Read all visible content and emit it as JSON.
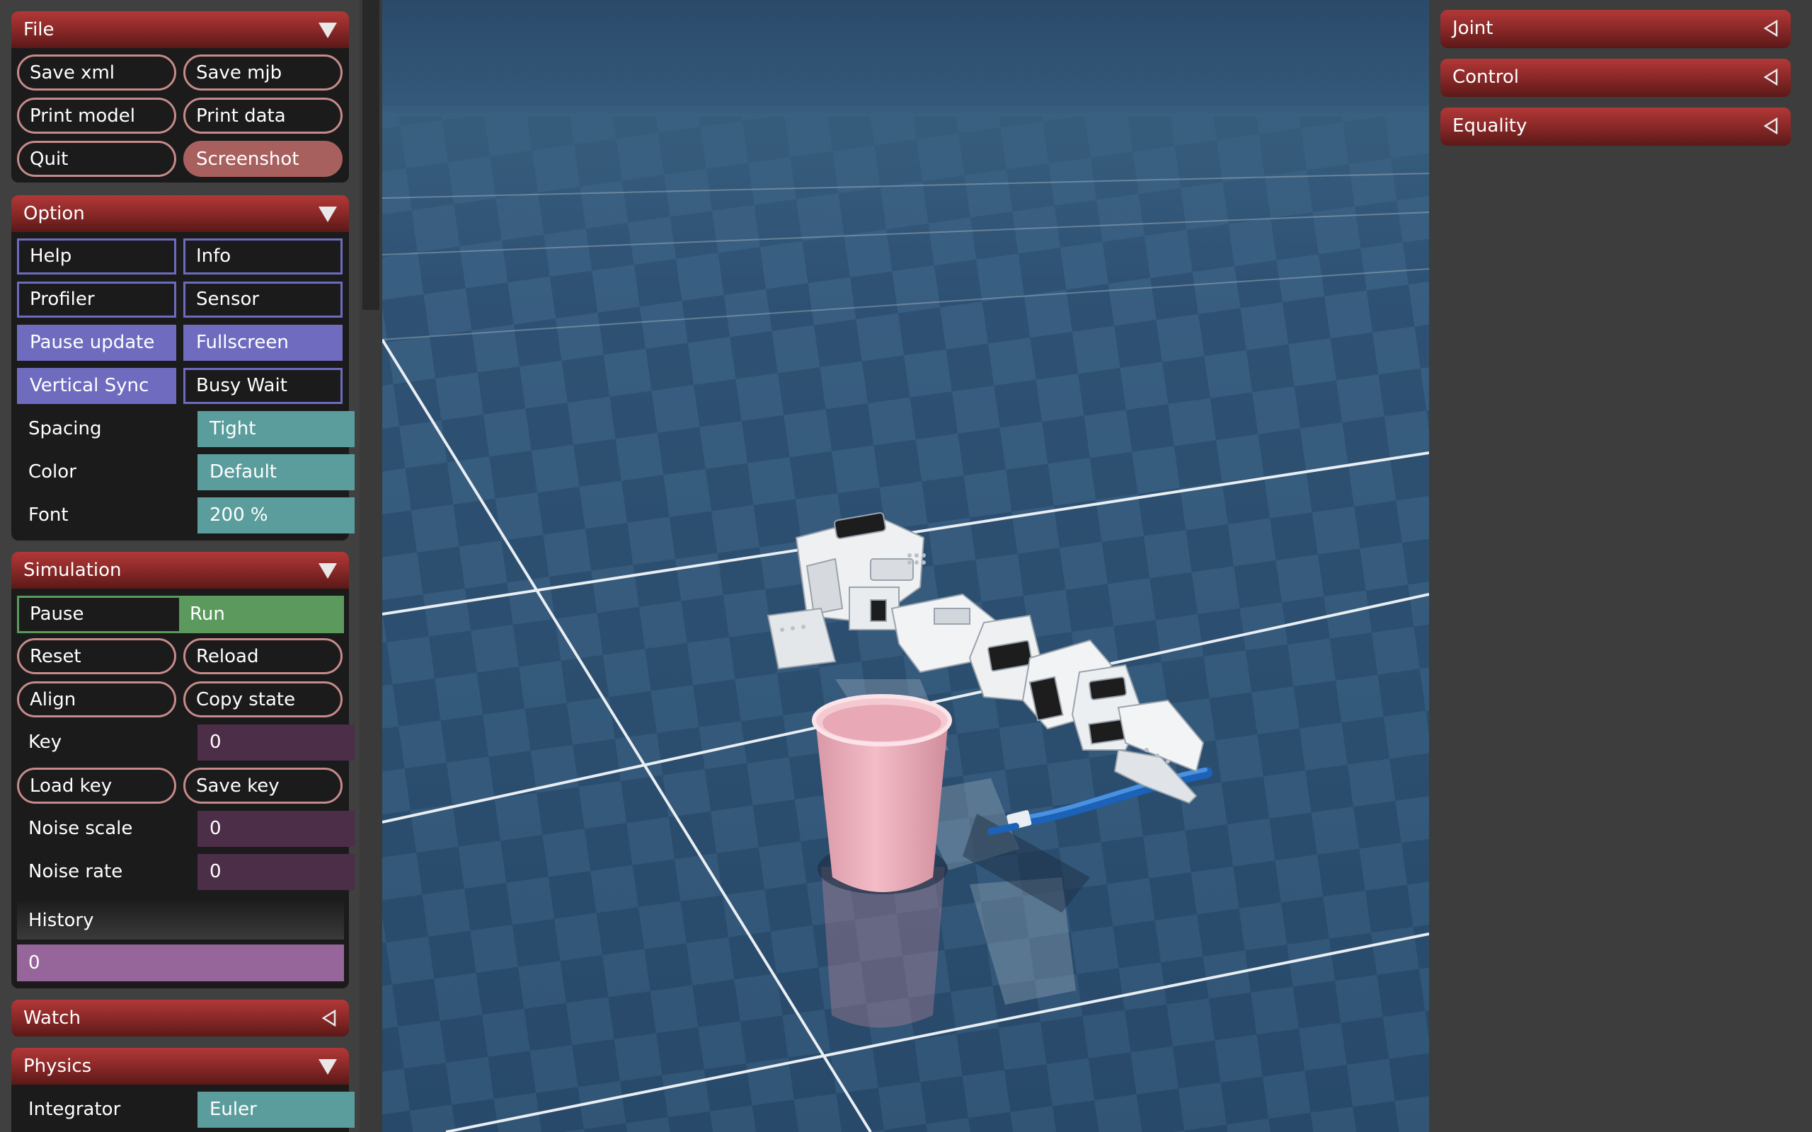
{
  "left_panel": {
    "file": {
      "title": "File",
      "buttons": {
        "save_xml": "Save xml",
        "save_mjb": "Save mjb",
        "print_model": "Print model",
        "print_data": "Print data",
        "quit": "Quit",
        "screenshot": "Screenshot"
      }
    },
    "option": {
      "title": "Option",
      "checks": {
        "help": "Help",
        "info": "Info",
        "profiler": "Profiler",
        "sensor": "Sensor",
        "pause_update": "Pause update",
        "fullscreen": "Fullscreen",
        "vertical_sync": "Vertical Sync",
        "busy_wait": "Busy Wait"
      },
      "spacing": {
        "label": "Spacing",
        "value": "Tight"
      },
      "color": {
        "label": "Color",
        "value": "Default"
      },
      "font": {
        "label": "Font",
        "value": "200 %"
      }
    },
    "simulation": {
      "title": "Simulation",
      "pause": "Pause",
      "run": "Run",
      "reset": "Reset",
      "reload": "Reload",
      "align": "Align",
      "copy_state": "Copy state",
      "key": {
        "label": "Key",
        "value": "0"
      },
      "load_key": "Load key",
      "save_key": "Save key",
      "noise_scale": {
        "label": "Noise scale",
        "value": "0"
      },
      "noise_rate": {
        "label": "Noise rate",
        "value": "0"
      },
      "history": {
        "label": "History",
        "value": "0"
      }
    },
    "watch": {
      "title": "Watch"
    },
    "physics": {
      "title": "Physics",
      "integrator": {
        "label": "Integrator",
        "value": "Euler"
      }
    }
  },
  "right_panel": {
    "joint": "Joint",
    "control": "Control",
    "equality": "Equality"
  },
  "colors": {
    "section_header": "#8e2a29",
    "button_border": "#c78a8a",
    "checkbox_on": "#6f6cbf",
    "select_bg": "#5b9d9c",
    "number_bg": "#4c2e48",
    "run_green": "#5b9a5c",
    "history_slider": "#96669a",
    "sky": "#2c4b6c",
    "cup": "#f0b5c0",
    "toothbrush": "#1e6ec8"
  },
  "icons": {
    "section_expanded": "triangle-down-icon",
    "section_collapsed": "triangle-left-icon"
  }
}
